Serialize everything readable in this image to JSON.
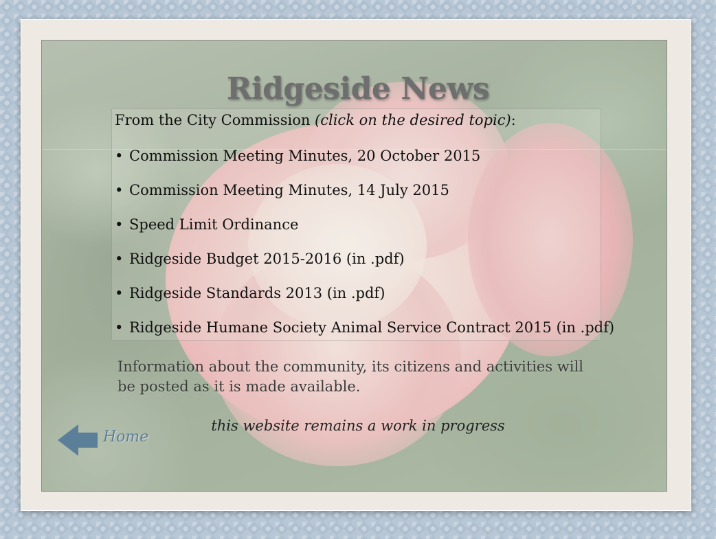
{
  "page": {
    "title": "Ridgeside News"
  },
  "commission": {
    "intro_prefix": "From the City Commission ",
    "intro_emphasis": "(click on the desired topic)",
    "intro_suffix": ":",
    "bullet": "•",
    "topics": [
      {
        "label": "Commission Meeting Minutes, 20 October 2015"
      },
      {
        "label": "Commission Meeting Minutes, 14 July 2015"
      },
      {
        "label": "Speed Limit Ordinance"
      },
      {
        "label": "Ridgeside Budget 2015-2016 (in .pdf)"
      },
      {
        "label": "Ridgeside Standards 2013 (in .pdf)"
      },
      {
        "label": "Ridgeside Humane Society Animal Service Contract 2015 (in .pdf)"
      }
    ]
  },
  "info": {
    "text": "Information about the community, its citizens and activities will be posted as it is made available."
  },
  "footer": {
    "wip": "this website remains a work in progress"
  },
  "nav": {
    "home_label": "Home",
    "home_icon": "left-arrow-icon",
    "arrow_color": "#5b7f98"
  }
}
